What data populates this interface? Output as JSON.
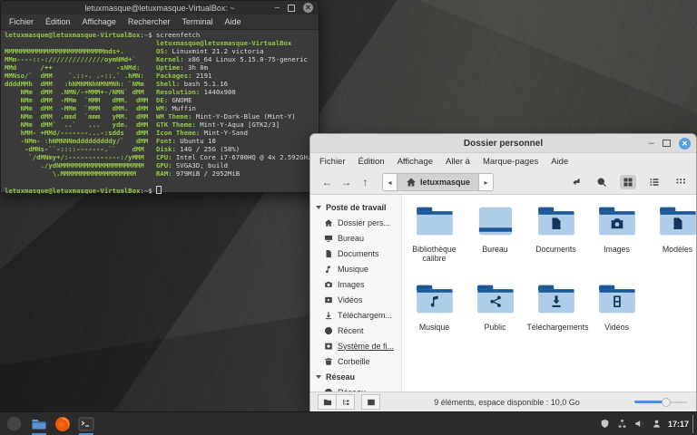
{
  "colors": {
    "accent": "#4c8fd6",
    "green": "#94c748",
    "folder_light": "#aecde9",
    "folder_dark": "#1b5996",
    "emblem": "#14365c"
  },
  "terminal_window": {
    "title": "letuxmasque@letuxmasque-VirtualBox: ~",
    "menu": [
      "Fichier",
      "Édition",
      "Affichage",
      "Rechercher",
      "Terminal",
      "Aide"
    ],
    "prompt": {
      "user_host": "letuxmasque@letuxmasque-VirtualBox",
      "separator": ":",
      "path": "~",
      "symbol": "$"
    },
    "command": "screenfetch",
    "ascii_art": [
      "",
      "MMMMMMMMMMMMMMMMMMMMMMMMMmds+.",
      "MMm----::-://////////////oymNMd+`",
      "MMd      /++                -sNMd:",
      "MMNso/`  dMM    `.::-. .-::.` .hMN:",
      "ddddMMh  dMM   :hNMNMNhNMNMNh: `NMm",
      "    NMm  dMM  .NMN/-+MMM+-/NMN` dMM",
      "    NMm  dMM  -MMm  `MMM   dMM.  dMM",
      "    NMm  dMM  -MMm  `MMM   dMM.  dMM",
      "    NMm  dMM  .mmd  `mmm   yMM.  dMM",
      "    NMm  dMM`  ..`   ...   ydm.  dMM",
      "    hMM- +MMd/-------...-:sdds   dMM",
      "    -NMm- :hNMNNNmdddddddddy/`   dMM",
      "     -dMNs-``-::::-------.``    dMM",
      "      `/dMNmy+/:-------------:/yMMM",
      "         ./ydNMMMMMMMMMMMMMMMMMMMMM",
      "            \\.MMMMMMMMMMMMMMMMMMM"
    ],
    "info": [
      {
        "label": "letuxmasque@letuxmasque-VirtualBox",
        "value": ""
      },
      {
        "label": "OS:",
        "value": "Linuxmint 21.2 victoria"
      },
      {
        "label": "Kernel:",
        "value": "x86_64 Linux 5.15.0-75-generic"
      },
      {
        "label": "Uptime:",
        "value": "3h 0m"
      },
      {
        "label": "Packages:",
        "value": "2191"
      },
      {
        "label": "Shell:",
        "value": "bash 5.1.16"
      },
      {
        "label": "Resolution:",
        "value": "1440x900"
      },
      {
        "label": "DE:",
        "value": "GNOME"
      },
      {
        "label": "WM:",
        "value": "Muffin"
      },
      {
        "label": "WM Theme:",
        "value": "Mint-Y-Dark-Blue (Mint-Y)"
      },
      {
        "label": "GTK Theme:",
        "value": "Mint-Y-Aqua [GTK2/3]"
      },
      {
        "label": "Icon Theme:",
        "value": "Mint-Y-Sand"
      },
      {
        "label": "Font:",
        "value": "Ubuntu 10"
      },
      {
        "label": "Disk:",
        "value": "14G / 25G (58%)"
      },
      {
        "label": "CPU:",
        "value": "Intel Core i7-6700HQ @ 4x 2.592GHz"
      },
      {
        "label": "GPU:",
        "value": "SVGA3D; build"
      },
      {
        "label": "RAM:",
        "value": "979MiB / 2952MiB"
      }
    ]
  },
  "file_manager": {
    "title": "Dossier personnel",
    "menu": [
      "Fichier",
      "Édition",
      "Affichage",
      "Aller à",
      "Marque-pages",
      "Aide"
    ],
    "breadcrumb": {
      "location": "letuxmasque",
      "back_arrow": "◂",
      "forward_arrow": "▸"
    },
    "nav": {
      "back": "←",
      "forward": "→",
      "up": "↑"
    },
    "sidebar": {
      "sections": [
        {
          "label": "Poste de travail",
          "items": [
            {
              "icon": "home-icon",
              "label": "Dossier pers..."
            },
            {
              "icon": "desktop-icon",
              "label": "Bureau"
            },
            {
              "icon": "document-icon",
              "label": "Documents"
            },
            {
              "icon": "music-icon",
              "label": "Musique"
            },
            {
              "icon": "camera-icon",
              "label": "Images"
            },
            {
              "icon": "video-icon",
              "label": "Vidéos"
            },
            {
              "icon": "download-icon",
              "label": "Téléchargem..."
            },
            {
              "icon": "clock-icon",
              "label": "Récent"
            },
            {
              "icon": "disk-icon",
              "label": "Système de fi...",
              "underline": true
            },
            {
              "icon": "trash-icon",
              "label": "Corbeille"
            }
          ]
        },
        {
          "label": "Réseau",
          "items": [
            {
              "icon": "globe-icon",
              "label": "Réseau"
            }
          ]
        }
      ]
    },
    "files": [
      {
        "label": "Bibliothèque calibre",
        "variant": "folder",
        "emblem": null
      },
      {
        "label": "Bureau",
        "variant": "desktop",
        "emblem": null
      },
      {
        "label": "Documents",
        "variant": "folder",
        "emblem": "document"
      },
      {
        "label": "Images",
        "variant": "folder",
        "emblem": "camera"
      },
      {
        "label": "Modèles",
        "variant": "folder",
        "emblem": "template"
      },
      {
        "label": "Musique",
        "variant": "folder",
        "emblem": "music"
      },
      {
        "label": "Public",
        "variant": "folder",
        "emblem": "share"
      },
      {
        "label": "Téléchargements",
        "variant": "folder",
        "emblem": "download"
      },
      {
        "label": "Vidéos",
        "variant": "folder",
        "emblem": "film"
      }
    ],
    "statusbar": {
      "text": "9 éléments, espace disponible : 10,0 Go"
    }
  },
  "taskbar": {
    "launchers": [
      {
        "icon": "files-icon",
        "open": true
      },
      {
        "icon": "firefox-icon",
        "open": false
      },
      {
        "icon": "terminal-icon",
        "open": true
      }
    ],
    "tray": [
      "shield-icon",
      "network-icon",
      "volume-icon",
      "user-icon"
    ],
    "clock": "17:17"
  }
}
